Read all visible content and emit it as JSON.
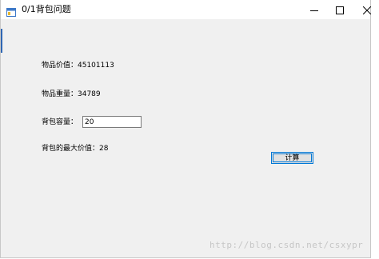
{
  "window": {
    "title": "0/1背包问题"
  },
  "form": {
    "value_label": "物品价值：45101113",
    "weight_label": "物品重量：34789",
    "capacity_label": "背包容量：",
    "capacity_value": "20",
    "max_value_label": "背包的最大价值：28",
    "compute_button": "计算"
  },
  "watermark": "http://blog.csdn.net/csxypr",
  "colors": {
    "window_bg": "#f0f0f0",
    "accent": "#0078d7",
    "watermark": "#c6c6c6"
  },
  "icons": {
    "app": "app-window-icon",
    "minimize": "minimize-icon",
    "maximize": "maximize-icon",
    "close": "close-icon"
  }
}
